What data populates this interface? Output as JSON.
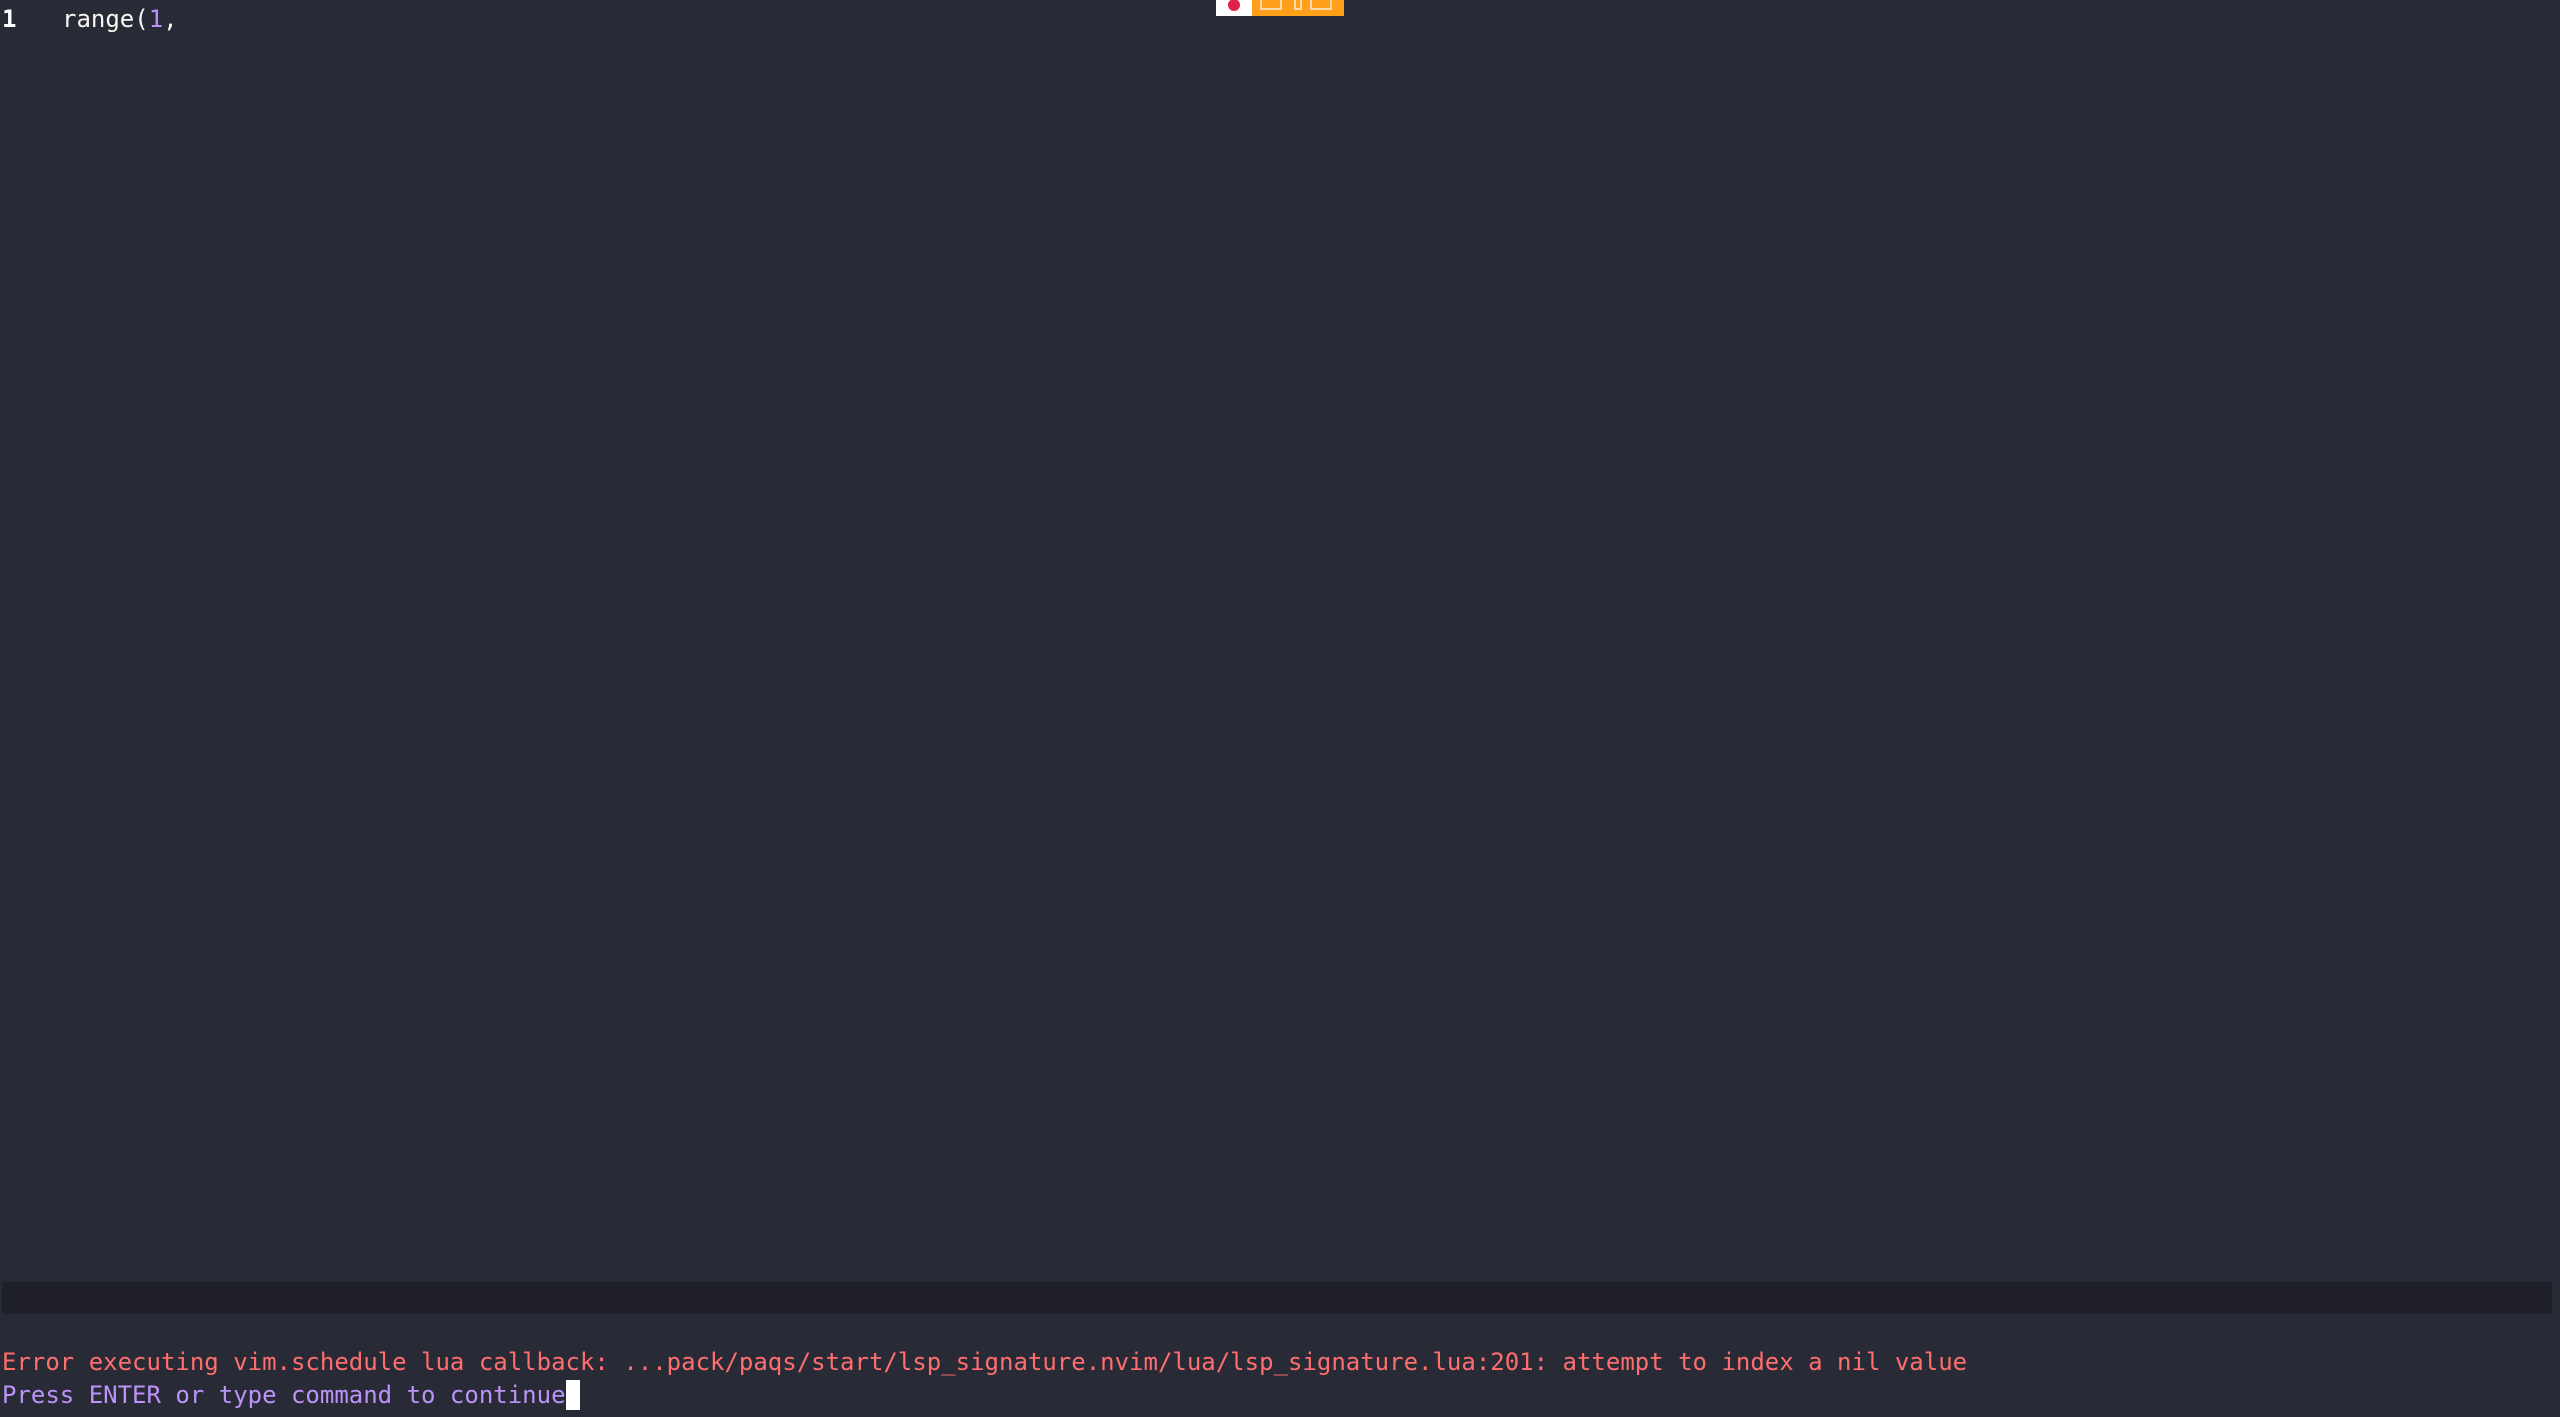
{
  "editor": {
    "lines": [
      {
        "number": "1",
        "tokens": {
          "fn": "range(",
          "num": "1",
          "punc": ","
        }
      }
    ]
  },
  "toolbar": {
    "icons": [
      "record-icon",
      "screen-share-icon",
      "pause-icon",
      "window-icon"
    ]
  },
  "messages": {
    "error": "Error executing vim.schedule lua callback: ...pack/paqs/start/lsp_signature.nvim/lua/lsp_signature.lua:201: attempt to index a nil value",
    "prompt": "Press ENTER or type command to continue"
  },
  "colors": {
    "background": "#282a36",
    "error": "#ff6e6e",
    "prompt": "#bd93f9",
    "toolbar": "#ff9f1a"
  }
}
